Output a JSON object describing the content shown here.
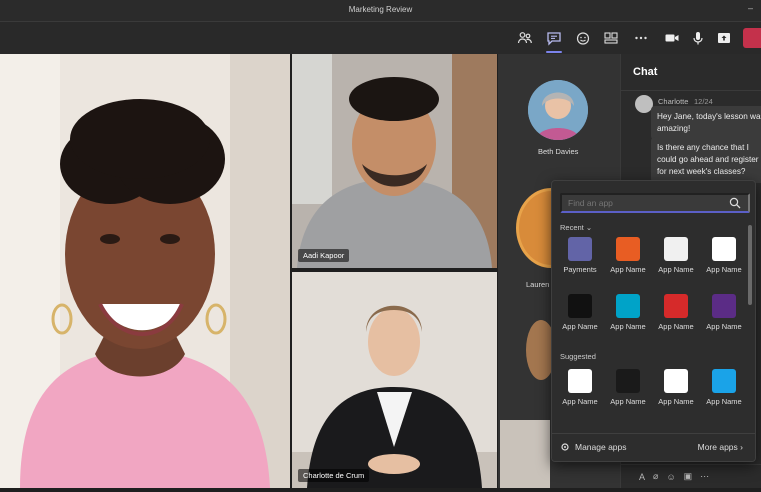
{
  "window": {
    "title": "Marketing Review",
    "close_glyph": "–"
  },
  "toolbar": {
    "icons": [
      "people-icon",
      "chat-icon",
      "reactions-icon",
      "share-tray-icon",
      "more-icon",
      "camera-icon",
      "mic-icon",
      "share-icon",
      "leave-icon"
    ],
    "active": "chat-icon",
    "leave_color": "#c4314b"
  },
  "participants": [
    {
      "name": ""
    },
    {
      "name": "Aadi Kapoor"
    },
    {
      "name": "Charlotte de Crum"
    }
  ],
  "roster": {
    "beth": "Beth Davies",
    "laurence": "Lauren"
  },
  "chat": {
    "heading": "Chat",
    "sender": "Charlotte",
    "time": "12/24",
    "message1": "Hey Jane, today's lesson was amazing!",
    "message2": "Is there any chance that I could go ahead and register for next week's classes?"
  },
  "apps_popup": {
    "search_placeholder": "Find an app",
    "recent_label": "Recent",
    "suggested_label": "Suggested",
    "recent_apps": [
      {
        "name": "Payments",
        "icon": "payments-app-icon",
        "color": "#6264a7"
      },
      {
        "name": "App Name",
        "icon": "orange-app-icon",
        "color": "#e85d23"
      },
      {
        "name": "App Name",
        "icon": "green-door-app-icon",
        "color": "#f0f0f0"
      },
      {
        "name": "App Name",
        "icon": "yellow-bubble-app-icon",
        "color": "#ffffff"
      },
      {
        "name": "App Name",
        "icon": "via-app-icon",
        "color": "#111111"
      },
      {
        "name": "App Name",
        "icon": "teal-snowflake-app-icon",
        "color": "#00a3c8"
      },
      {
        "name": "App Name",
        "icon": "red-m-app-icon",
        "color": "#d62a2a"
      },
      {
        "name": "App Name",
        "icon": "purple-stripes-app-icon",
        "color": "#5b2c86"
      }
    ],
    "suggested_apps": [
      {
        "name": "App Name",
        "icon": "fk-app-icon",
        "color": "#ffffff"
      },
      {
        "name": "App Name",
        "icon": "rr-app-icon",
        "color": "#1a1a1a"
      },
      {
        "name": "App Name",
        "icon": "flag-app-icon",
        "color": "#ffffff"
      },
      {
        "name": "App Name",
        "icon": "blue-square-app-icon",
        "color": "#1aa3e8"
      }
    ],
    "manage_label": "Manage apps",
    "more_label": "More apps"
  }
}
